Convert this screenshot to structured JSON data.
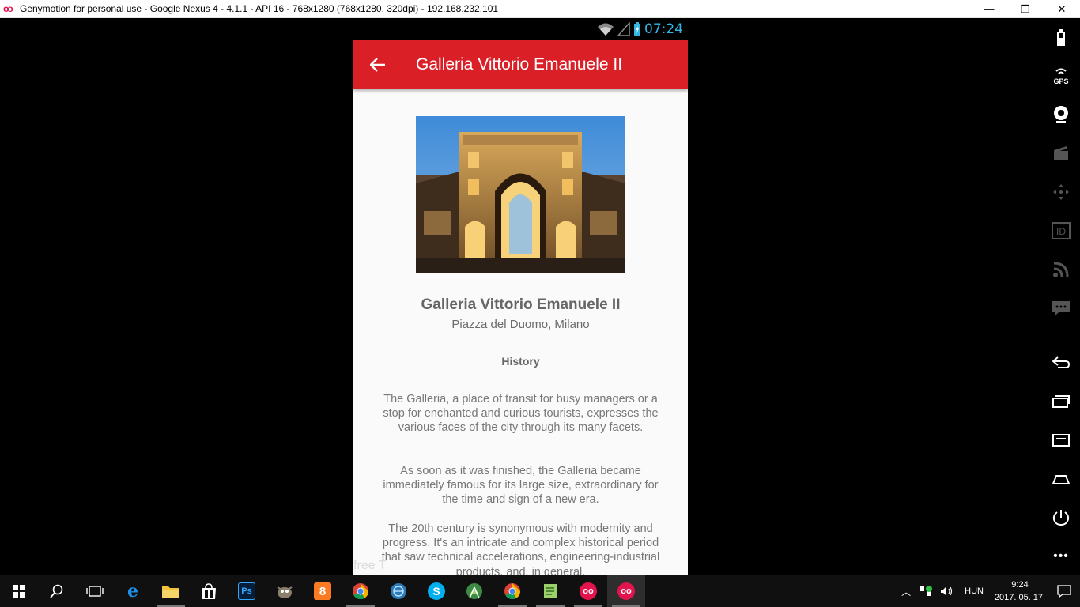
{
  "window": {
    "title": "Genymotion for personal use - Google Nexus 4 - 4.1.1 - API 16 - 768x1280 (768x1280, 320dpi) - 192.168.232.101",
    "logo_text": "oo",
    "minimize": "—",
    "restore": "❐",
    "close": "✕"
  },
  "statusbar": {
    "time": "07:24"
  },
  "appbar": {
    "title": "Galleria Vittorio Emanuele II"
  },
  "content": {
    "title": "Galleria Vittorio Emanuele II",
    "subtitle": "Piazza del Duomo, Milano",
    "section": "History",
    "paragraphs": [
      "The Galleria, a place of transit for busy managers or a stop for enchanted and curious tourists, expresses the various faces of the city through its many facets.",
      "As soon as it was finished, the Galleria became immediately famous for its large size, extraordinary for the time and sign of a new era.",
      "The 20th century is synonymous with modernity and progress. It's an intricate and complex historical period that saw technical accelerations, engineering-industrial products, and, in general,"
    ],
    "watermark": "free T"
  },
  "sidebar": [
    "battery-icon",
    "gps-icon",
    "webcam-icon",
    "capture-icon",
    "dpad-icon",
    "id-icon",
    "rss-icon",
    "sms-icon",
    "back-icon",
    "recent-apps-icon",
    "menu-icon",
    "home-icon",
    "power-icon",
    "more-icon"
  ],
  "sidebar_labels": {
    "gps": "GPS",
    "id": "ID",
    "more": "•••"
  },
  "taskbar": {
    "apps": [
      {
        "name": "start",
        "label": ""
      },
      {
        "name": "search",
        "label": ""
      },
      {
        "name": "task-view",
        "label": ""
      },
      {
        "name": "edge",
        "label": "e"
      },
      {
        "name": "file-explorer",
        "label": ""
      },
      {
        "name": "store",
        "label": ""
      },
      {
        "name": "photoshop",
        "label": "Ps"
      },
      {
        "name": "gimp",
        "label": ""
      },
      {
        "name": "xampp",
        "label": "8"
      },
      {
        "name": "chrome",
        "label": ""
      },
      {
        "name": "network",
        "label": ""
      },
      {
        "name": "skype",
        "label": "S"
      },
      {
        "name": "android-studio",
        "label": ""
      },
      {
        "name": "chrome-2",
        "label": ""
      },
      {
        "name": "notepad",
        "label": ""
      },
      {
        "name": "genymotion",
        "label": "oo"
      },
      {
        "name": "genymotion-2",
        "label": "oo"
      }
    ],
    "language": "HUN",
    "clock_time": "9:24",
    "clock_date": "2017. 05. 17."
  },
  "colors": {
    "appbar": "#da1f27",
    "status_time": "#33b5e5",
    "page_bg": "#fafafa"
  }
}
